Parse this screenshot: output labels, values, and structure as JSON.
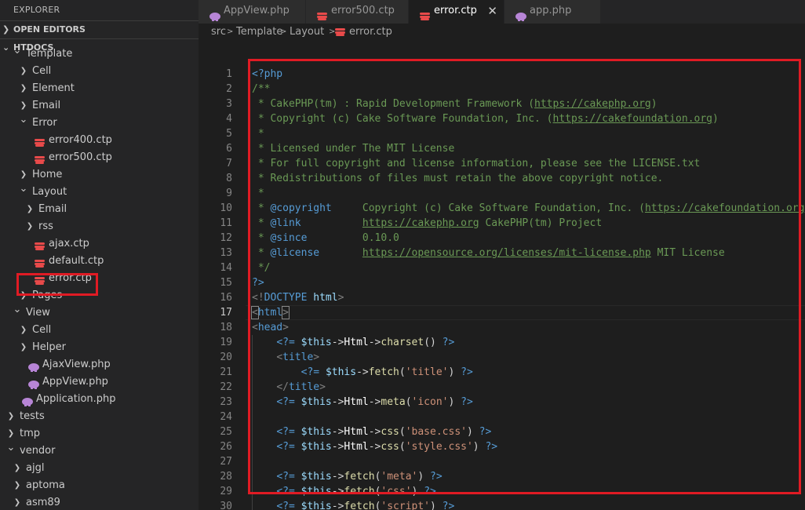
{
  "sidebar": {
    "title": "EXPLORER",
    "open_editors": "OPEN EDITORS",
    "folder": "HTDOCS",
    "tree": [
      {
        "label": "Template",
        "type": "folder",
        "open": true,
        "depth": 1
      },
      {
        "label": "Cell",
        "type": "folder",
        "open": false,
        "depth": 2
      },
      {
        "label": "Element",
        "type": "folder",
        "open": false,
        "depth": 2
      },
      {
        "label": "Email",
        "type": "folder",
        "open": false,
        "depth": 2
      },
      {
        "label": "Error",
        "type": "folder",
        "open": true,
        "depth": 2
      },
      {
        "label": "error400.ctp",
        "type": "cake",
        "depth": 3
      },
      {
        "label": "error500.ctp",
        "type": "cake",
        "depth": 3
      },
      {
        "label": "Home",
        "type": "folder",
        "open": false,
        "depth": 2
      },
      {
        "label": "Layout",
        "type": "folder",
        "open": true,
        "depth": 2
      },
      {
        "label": "Email",
        "type": "folder",
        "open": false,
        "depth": 3
      },
      {
        "label": "rss",
        "type": "folder",
        "open": false,
        "depth": 3
      },
      {
        "label": "ajax.ctp",
        "type": "cake",
        "depth": 3
      },
      {
        "label": "default.ctp",
        "type": "cake",
        "depth": 3
      },
      {
        "label": "error.ctp",
        "type": "cake",
        "depth": 3
      },
      {
        "label": "Pages",
        "type": "folder",
        "open": false,
        "depth": 2
      },
      {
        "label": "View",
        "type": "folder",
        "open": true,
        "depth": 1
      },
      {
        "label": "Cell",
        "type": "folder",
        "open": false,
        "depth": 2
      },
      {
        "label": "Helper",
        "type": "folder",
        "open": false,
        "depth": 2
      },
      {
        "label": "AjaxView.php",
        "type": "php",
        "depth": 2
      },
      {
        "label": "AppView.php",
        "type": "php",
        "depth": 2
      },
      {
        "label": "Application.php",
        "type": "php",
        "depth": 1
      },
      {
        "label": "tests",
        "type": "folder",
        "open": false,
        "depth": 0
      },
      {
        "label": "tmp",
        "type": "folder",
        "open": false,
        "depth": 0
      },
      {
        "label": "vendor",
        "type": "folder",
        "open": true,
        "depth": 0
      },
      {
        "label": "ajgl",
        "type": "folder",
        "open": false,
        "depth": 1
      },
      {
        "label": "aptoma",
        "type": "folder",
        "open": false,
        "depth": 1
      },
      {
        "label": "asm89",
        "type": "folder",
        "open": false,
        "depth": 1
      }
    ]
  },
  "tabs": [
    {
      "label": "AppView.php",
      "icon": "php-icon",
      "active": false
    },
    {
      "label": "error500.ctp",
      "icon": "cake-icon",
      "active": false
    },
    {
      "label": "error.ctp",
      "icon": "cake-icon",
      "active": true,
      "close": "✕"
    },
    {
      "label": "app.php",
      "icon": "php-icon",
      "active": false
    }
  ],
  "breadcrumb": {
    "parts": [
      "src",
      "Template",
      "Layout",
      "error.ctp"
    ],
    "sep": ">"
  },
  "editor": {
    "current_line": 17,
    "lines": [
      [
        [
          "c-php",
          "<?php"
        ]
      ],
      [
        [
          "c-cm",
          "/**"
        ]
      ],
      [
        [
          "c-cm",
          " * CakePHP(tm) : Rapid Development Framework ("
        ],
        [
          "c-cm u",
          "https://cakephp.org"
        ],
        [
          "c-cm",
          ")"
        ]
      ],
      [
        [
          "c-cm",
          " * Copyright (c) Cake Software Foundation, Inc. ("
        ],
        [
          "c-cm u",
          "https://cakefoundation.org"
        ],
        [
          "c-cm",
          ")"
        ]
      ],
      [
        [
          "c-cm",
          " *"
        ]
      ],
      [
        [
          "c-cm",
          " * Licensed under The MIT License"
        ]
      ],
      [
        [
          "c-cm",
          " * For full copyright and license information, please see the LICENSE.txt"
        ]
      ],
      [
        [
          "c-cm",
          " * Redistributions of files must retain the above copyright notice."
        ]
      ],
      [
        [
          "c-cm",
          " *"
        ]
      ],
      [
        [
          "c-cm",
          " * "
        ],
        [
          "c-doc",
          "@copyright"
        ],
        [
          "c-cm",
          "     Copyright (c) Cake Software Foundation, Inc. ("
        ],
        [
          "c-cm u",
          "https://cakefoundation.org"
        ]
      ],
      [
        [
          "c-cm",
          " * "
        ],
        [
          "c-doc",
          "@link"
        ],
        [
          "c-cm",
          "          "
        ],
        [
          "c-cm u",
          "https://cakephp.org"
        ],
        [
          "c-cm",
          " CakePHP(tm) Project"
        ]
      ],
      [
        [
          "c-cm",
          " * "
        ],
        [
          "c-doc",
          "@since"
        ],
        [
          "c-cm",
          "         0.10.0"
        ]
      ],
      [
        [
          "c-cm",
          " * "
        ],
        [
          "c-doc",
          "@license"
        ],
        [
          "c-cm",
          "       "
        ],
        [
          "c-cm u",
          "https://opensource.org/licenses/mit-license.php"
        ],
        [
          "c-cm",
          " MIT License"
        ]
      ],
      [
        [
          "c-cm",
          " */"
        ]
      ],
      [
        [
          "c-php",
          "?>"
        ]
      ],
      [
        [
          "c-bracket",
          "<!"
        ],
        [
          "c-tag",
          "DOCTYPE"
        ],
        [
          "c-op",
          " "
        ],
        [
          "c-var",
          "html"
        ],
        [
          "c-bracket",
          ">"
        ]
      ],
      [
        [
          "c-bracket bm",
          "<"
        ],
        [
          "c-tag",
          "html"
        ],
        [
          "c-bracket bm",
          ">"
        ]
      ],
      [
        [
          "c-bracket",
          "<"
        ],
        [
          "c-tag",
          "head"
        ],
        [
          "c-bracket",
          ">"
        ]
      ],
      [
        [
          "c-op",
          "    "
        ],
        [
          "c-php",
          "<?="
        ],
        [
          "c-op",
          " "
        ],
        [
          "c-var",
          "$this"
        ],
        [
          "c-op",
          "->"
        ],
        [
          "c-cls",
          "Html"
        ],
        [
          "c-op",
          "->"
        ],
        [
          "c-fn",
          "charset"
        ],
        [
          "c-op",
          "() "
        ],
        [
          "c-php",
          "?>"
        ]
      ],
      [
        [
          "c-op",
          "    "
        ],
        [
          "c-bracket",
          "<"
        ],
        [
          "c-tag",
          "title"
        ],
        [
          "c-bracket",
          ">"
        ]
      ],
      [
        [
          "c-op",
          "        "
        ],
        [
          "c-php",
          "<?="
        ],
        [
          "c-op",
          " "
        ],
        [
          "c-var",
          "$this"
        ],
        [
          "c-op",
          "->"
        ],
        [
          "c-fn",
          "fetch"
        ],
        [
          "c-op",
          "("
        ],
        [
          "c-str",
          "'title'"
        ],
        [
          "c-op",
          ") "
        ],
        [
          "c-php",
          "?>"
        ]
      ],
      [
        [
          "c-op",
          "    "
        ],
        [
          "c-bracket",
          "</"
        ],
        [
          "c-tag",
          "title"
        ],
        [
          "c-bracket",
          ">"
        ]
      ],
      [
        [
          "c-op",
          "    "
        ],
        [
          "c-php",
          "<?="
        ],
        [
          "c-op",
          " "
        ],
        [
          "c-var",
          "$this"
        ],
        [
          "c-op",
          "->"
        ],
        [
          "c-cls",
          "Html"
        ],
        [
          "c-op",
          "->"
        ],
        [
          "c-fn",
          "meta"
        ],
        [
          "c-op",
          "("
        ],
        [
          "c-str",
          "'icon'"
        ],
        [
          "c-op",
          ") "
        ],
        [
          "c-php",
          "?>"
        ]
      ],
      [],
      [
        [
          "c-op",
          "    "
        ],
        [
          "c-php",
          "<?="
        ],
        [
          "c-op",
          " "
        ],
        [
          "c-var",
          "$this"
        ],
        [
          "c-op",
          "->"
        ],
        [
          "c-cls",
          "Html"
        ],
        [
          "c-op",
          "->"
        ],
        [
          "c-fn",
          "css"
        ],
        [
          "c-op",
          "("
        ],
        [
          "c-str",
          "'base.css'"
        ],
        [
          "c-op",
          ") "
        ],
        [
          "c-php",
          "?>"
        ]
      ],
      [
        [
          "c-op",
          "    "
        ],
        [
          "c-php",
          "<?="
        ],
        [
          "c-op",
          " "
        ],
        [
          "c-var",
          "$this"
        ],
        [
          "c-op",
          "->"
        ],
        [
          "c-cls",
          "Html"
        ],
        [
          "c-op",
          "->"
        ],
        [
          "c-fn",
          "css"
        ],
        [
          "c-op",
          "("
        ],
        [
          "c-str",
          "'style.css'"
        ],
        [
          "c-op",
          ") "
        ],
        [
          "c-php",
          "?>"
        ]
      ],
      [],
      [
        [
          "c-op",
          "    "
        ],
        [
          "c-php",
          "<?="
        ],
        [
          "c-op",
          " "
        ],
        [
          "c-var",
          "$this"
        ],
        [
          "c-op",
          "->"
        ],
        [
          "c-fn",
          "fetch"
        ],
        [
          "c-op",
          "("
        ],
        [
          "c-str",
          "'meta'"
        ],
        [
          "c-op",
          ") "
        ],
        [
          "c-php",
          "?>"
        ]
      ],
      [
        [
          "c-op",
          "    "
        ],
        [
          "c-php",
          "<?="
        ],
        [
          "c-op",
          " "
        ],
        [
          "c-var",
          "$this"
        ],
        [
          "c-op",
          "->"
        ],
        [
          "c-fn",
          "fetch"
        ],
        [
          "c-op",
          "("
        ],
        [
          "c-str",
          "'css'"
        ],
        [
          "c-op",
          ") "
        ],
        [
          "c-php",
          "?>"
        ]
      ],
      [
        [
          "c-op",
          "    "
        ],
        [
          "c-php",
          "<?="
        ],
        [
          "c-op",
          " "
        ],
        [
          "c-var",
          "$this"
        ],
        [
          "c-op",
          "->"
        ],
        [
          "c-fn",
          "fetch"
        ],
        [
          "c-op",
          "("
        ],
        [
          "c-str",
          "'script'"
        ],
        [
          "c-op",
          ") "
        ],
        [
          "c-php",
          "?>"
        ]
      ]
    ]
  },
  "colors": {
    "highlight": "#e01b24",
    "accent": "#569cd6"
  }
}
